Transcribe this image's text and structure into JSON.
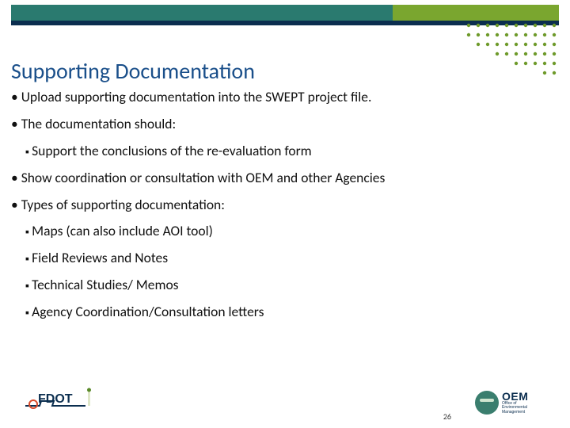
{
  "title": "Supporting Documentation",
  "bullets": {
    "b1": "Upload supporting documentation into the SWEPT project file.",
    "b2": "The documentation should:",
    "b2a": "Support the conclusions of the re-evaluation form",
    "b3": "Show coordination or consultation with OEM and other Agencies",
    "b4": "Types of supporting documentation:",
    "b4a": "Maps (can also include AOI tool)",
    "b4b": "Field Reviews and Notes",
    "b4c": "Technical Studies/ Memos",
    "b4d": "Agency Coordination/Consultation letters"
  },
  "page_number": "26",
  "logos": {
    "fdot_label": "FDOT",
    "oem_big": "OEM",
    "oem_small1": "Office of",
    "oem_small2": "Environmental",
    "oem_small3": "Management"
  },
  "colors": {
    "title": "#1a4f8a",
    "bar_teal": "#2a7a6f",
    "bar_green": "#7aa62f",
    "bar_navy": "#0b2e4f",
    "dot_green": "#6e9a2a"
  }
}
